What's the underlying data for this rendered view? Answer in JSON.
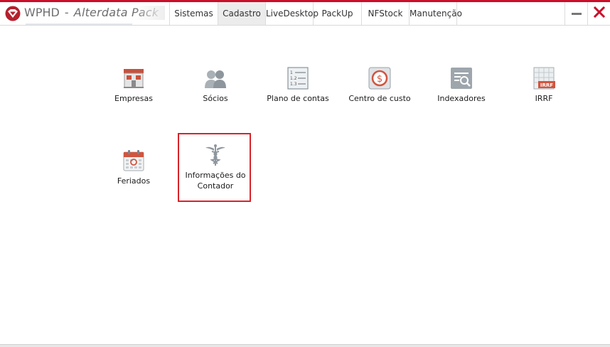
{
  "window": {
    "title_main": "WPHD",
    "title_sep": "-",
    "title_sub": "Alterdata Pack",
    "accent": "#c9102b"
  },
  "menu": [
    {
      "label": "Sistemas",
      "active": false
    },
    {
      "label": "Cadastro",
      "active": true
    },
    {
      "label": "LiveDesktop",
      "active": false
    },
    {
      "label": "PackUp",
      "active": false
    },
    {
      "label": "NFStock",
      "active": false
    },
    {
      "label": "Manutenção",
      "active": false
    }
  ],
  "tiles": [
    {
      "id": "empresas",
      "label": "Empresas",
      "icon": "building-icon"
    },
    {
      "id": "socios",
      "label": "Sócios",
      "icon": "partners-icon"
    },
    {
      "id": "plano-de-contas",
      "label": "Plano de contas",
      "icon": "numbered-list-icon"
    },
    {
      "id": "centro-de-custo",
      "label": "Centro de custo",
      "icon": "dollar-coin-icon"
    },
    {
      "id": "indexadores",
      "label": "Indexadores",
      "icon": "document-search-icon"
    },
    {
      "id": "irrf",
      "label": "IRRF",
      "icon": "irrf-table-icon"
    },
    {
      "id": "feriados",
      "label": "Feriados",
      "icon": "calendar-icon"
    },
    {
      "id": "informacoes-do-contador",
      "label": "Informações do Contador",
      "icon": "caduceus-icon"
    }
  ]
}
